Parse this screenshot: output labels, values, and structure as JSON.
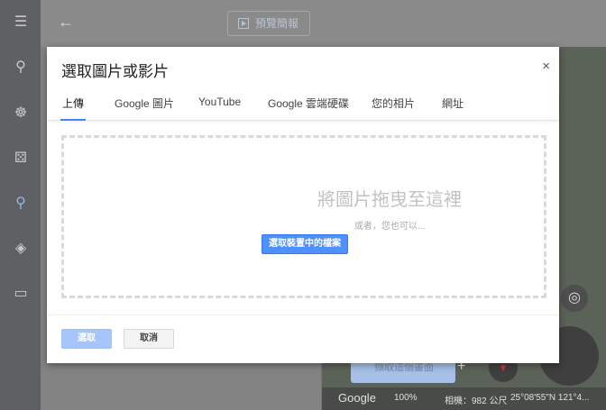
{
  "topbar": {
    "preview_label": "預覽簡報"
  },
  "dialog": {
    "title": "選取圖片或影片",
    "close": "×",
    "tabs": [
      "上傳",
      "Google 圖片",
      "YouTube",
      "Google 雲端硬碟",
      "您的相片",
      "網址"
    ],
    "active_tab": 0,
    "drop_title": "將圖片拖曳至這裡",
    "drop_or": "或者，您也可以...",
    "pick_button": "選取裝置中的檔案",
    "select_button": "選取",
    "cancel_button": "取消"
  },
  "map": {
    "capture_label": "擷取這個畫面",
    "plus": "+",
    "logo": "Google",
    "zoom": "100%",
    "camera": "相機：982 公尺",
    "coords": "25°08'55\"N 121°4..."
  },
  "colors": {
    "accent": "#4285f4",
    "pick": "#4d90fe"
  }
}
